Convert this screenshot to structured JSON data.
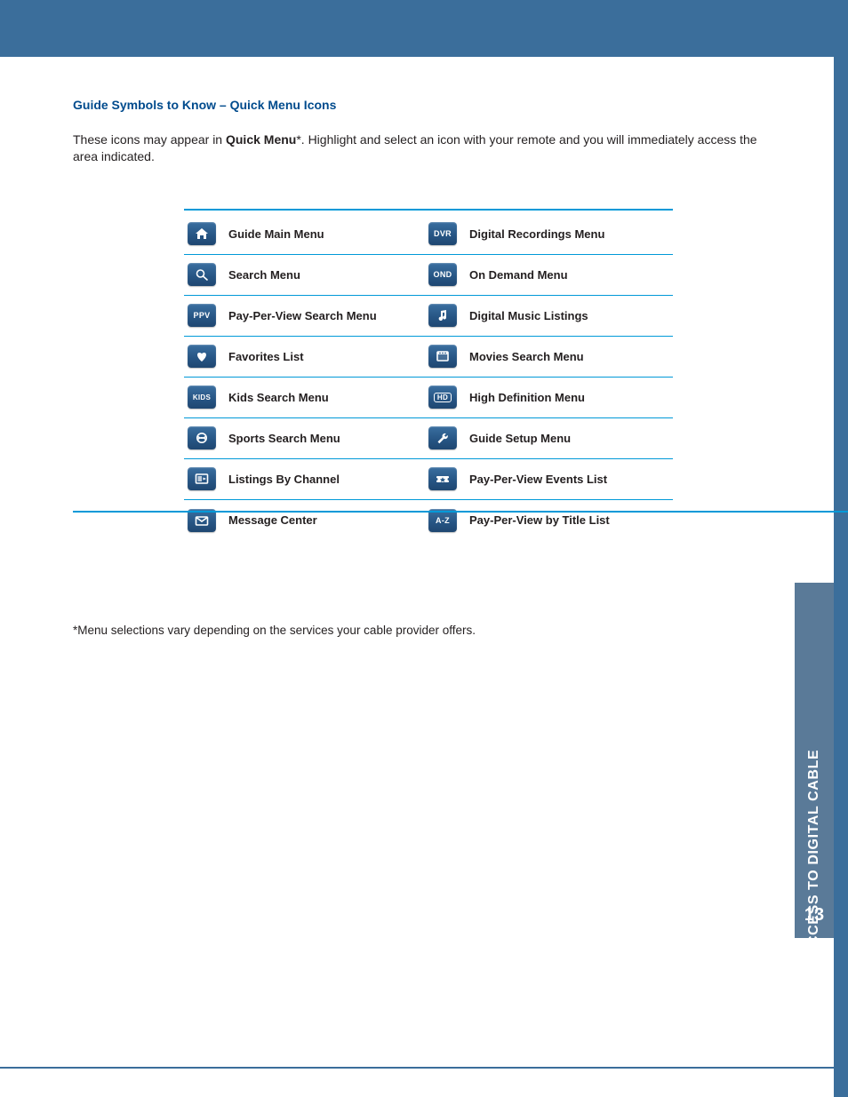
{
  "heading": "Guide Symbols to Know – Quick Menu Icons",
  "intro_before": "These icons may appear in ",
  "intro_bold": "Quick Menu",
  "intro_after": "*. Highlight and select an icon with your remote and you will immediately access the area indicated.",
  "footnote": "*Menu selections vary depending on the services your cable provider offers.",
  "side_label": "YOUR ACCESS TO DIGITAL CABLE",
  "page_number": "13",
  "rows": [
    {
      "left": {
        "icon": "home",
        "label": "Guide Main Menu"
      },
      "right": {
        "icon": "dvr",
        "label": "Digital Recordings Menu"
      }
    },
    {
      "left": {
        "icon": "search",
        "label": "Search Menu"
      },
      "right": {
        "icon": "ond",
        "label": "On Demand Menu"
      }
    },
    {
      "left": {
        "icon": "ppv",
        "label": "Pay-Per-View Search Menu"
      },
      "right": {
        "icon": "music",
        "label": "Digital Music Listings"
      }
    },
    {
      "left": {
        "icon": "heart",
        "label": "Favorites List"
      },
      "right": {
        "icon": "movies",
        "label": "Movies Search Menu"
      }
    },
    {
      "left": {
        "icon": "kids",
        "label": "Kids Search Menu"
      },
      "right": {
        "icon": "hd",
        "label": "High Definition Menu"
      }
    },
    {
      "left": {
        "icon": "sports",
        "label": "Sports Search Menu"
      },
      "right": {
        "icon": "wrench",
        "label": "Guide Setup Menu"
      }
    },
    {
      "left": {
        "icon": "listings",
        "label": "Listings By Channel"
      },
      "right": {
        "icon": "ticket",
        "label": "Pay-Per-View Events List"
      }
    },
    {
      "left": {
        "icon": "mail",
        "label": "Message Center"
      },
      "right": {
        "icon": "az",
        "label": "Pay-Per-View by Title List"
      }
    }
  ],
  "icon_text": {
    "dvr": "DVR",
    "ond": "OND",
    "ppv": "PPV",
    "kids": "KIDS",
    "hd": "HD",
    "az": "A-Z"
  }
}
